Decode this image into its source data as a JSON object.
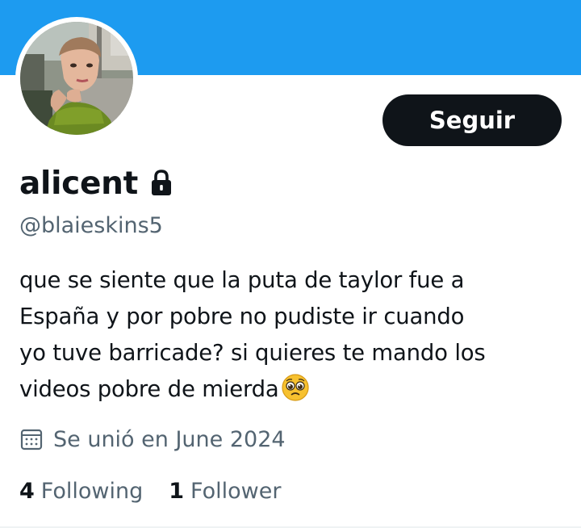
{
  "profile": {
    "display_name": "alicent",
    "handle": "@blaieskins5",
    "bio": "que se siente que la puta de taylor fue a\nEspaña y por pobre no pudiste ir cuando\nyo tuve barricade? si quieres te mando los\nvideos pobre de mierda",
    "bio_emoji": "pleading-face-icon",
    "joined": "Se unió en June 2024",
    "protected": true
  },
  "actions": {
    "follow_label": "Seguir"
  },
  "stats": {
    "following_count": "4",
    "following_label": "Following",
    "followers_count": "1",
    "followers_label": "Follower"
  },
  "colors": {
    "banner": "#1d9bf0",
    "primary_text": "#0f1419",
    "secondary_text": "#536471",
    "button_bg": "#0f1419"
  }
}
